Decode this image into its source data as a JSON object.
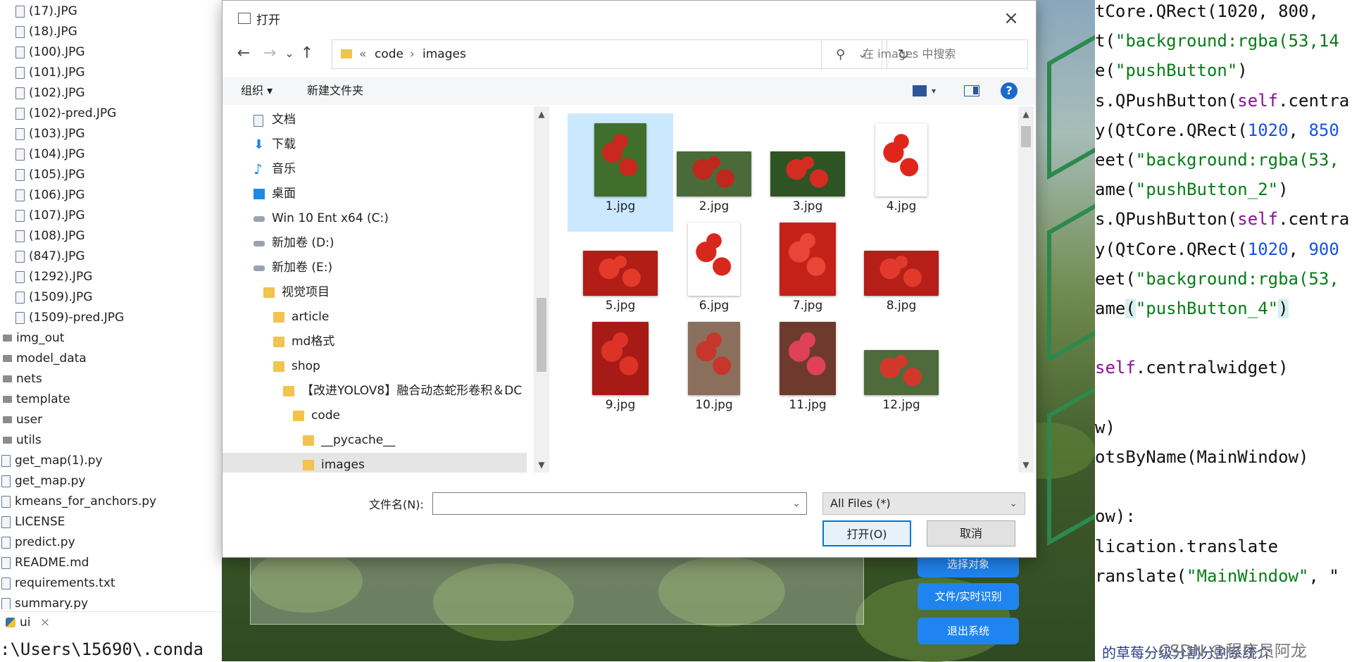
{
  "ide": {
    "tree": [
      {
        "name": "(17).JPG",
        "type": "file",
        "indent": 1
      },
      {
        "name": "(18).JPG",
        "type": "file",
        "indent": 1
      },
      {
        "name": "(100).JPG",
        "type": "file",
        "indent": 1
      },
      {
        "name": "(101).JPG",
        "type": "file",
        "indent": 1
      },
      {
        "name": "(102).JPG",
        "type": "file",
        "indent": 1
      },
      {
        "name": "(102)-pred.JPG",
        "type": "file",
        "indent": 1
      },
      {
        "name": "(103).JPG",
        "type": "file",
        "indent": 1
      },
      {
        "name": "(104).JPG",
        "type": "file",
        "indent": 1
      },
      {
        "name": "(105).JPG",
        "type": "file",
        "indent": 1
      },
      {
        "name": "(106).JPG",
        "type": "file",
        "indent": 1
      },
      {
        "name": "(107).JPG",
        "type": "file",
        "indent": 1
      },
      {
        "name": "(108).JPG",
        "type": "file",
        "indent": 1
      },
      {
        "name": "(847).JPG",
        "type": "file",
        "indent": 1
      },
      {
        "name": "(1292).JPG",
        "type": "file",
        "indent": 1
      },
      {
        "name": "(1509).JPG",
        "type": "file",
        "indent": 1
      },
      {
        "name": "(1509)-pred.JPG",
        "type": "file",
        "indent": 1
      },
      {
        "name": "img_out",
        "type": "dir",
        "indent": 0
      },
      {
        "name": "model_data",
        "type": "dir",
        "indent": 0
      },
      {
        "name": "nets",
        "type": "dir",
        "indent": 0
      },
      {
        "name": "template",
        "type": "dir",
        "indent": 0
      },
      {
        "name": "user",
        "type": "dir",
        "indent": 0
      },
      {
        "name": "utils",
        "type": "dir",
        "indent": 0
      },
      {
        "name": "get_map(1).py",
        "type": "file",
        "indent": 0
      },
      {
        "name": "get_map.py",
        "type": "file",
        "indent": 0
      },
      {
        "name": "kmeans_for_anchors.py",
        "type": "file",
        "indent": 0
      },
      {
        "name": "LICENSE",
        "type": "file",
        "indent": 0
      },
      {
        "name": "predict.py",
        "type": "file",
        "indent": 0
      },
      {
        "name": "README.md",
        "type": "file",
        "indent": 0
      },
      {
        "name": "requirements.txt",
        "type": "file",
        "indent": 0
      },
      {
        "name": "summary.py",
        "type": "file",
        "indent": 0
      }
    ],
    "run_tab": "ui",
    "run_tab_close": "×",
    "terminal": ":\\Users\\15690\\.conda",
    "code_lines": [
      {
        "segs": [
          {
            "t": "tCore.QRect(1020, 800,",
            "c": ""
          }
        ]
      },
      {
        "segs": [
          {
            "t": "t(",
            "c": ""
          },
          {
            "t": "\"background:rgba(53,14",
            "c": "s"
          }
        ]
      },
      {
        "segs": [
          {
            "t": "e(",
            "c": ""
          },
          {
            "t": "\"pushButton\"",
            "c": "s"
          },
          {
            "t": ")",
            "c": ""
          }
        ]
      },
      {
        "segs": [
          {
            "t": "s.QPushButton(",
            "c": ""
          },
          {
            "t": "self",
            "c": "k"
          },
          {
            "t": ".centra",
            "c": ""
          }
        ]
      },
      {
        "segs": [
          {
            "t": "y(QtCore.QRect(",
            "c": ""
          },
          {
            "t": "1020",
            "c": "n"
          },
          {
            "t": ", ",
            "c": ""
          },
          {
            "t": "850",
            "c": "n"
          }
        ]
      },
      {
        "segs": [
          {
            "t": "eet(",
            "c": ""
          },
          {
            "t": "\"background:rgba(53,",
            "c": "s"
          }
        ]
      },
      {
        "segs": [
          {
            "t": "ame(",
            "c": ""
          },
          {
            "t": "\"pushButton_2\"",
            "c": "s"
          },
          {
            "t": ")",
            "c": ""
          }
        ]
      },
      {
        "segs": [
          {
            "t": "s.QPushButton(",
            "c": ""
          },
          {
            "t": "self",
            "c": "k"
          },
          {
            "t": ".centra",
            "c": ""
          }
        ]
      },
      {
        "segs": [
          {
            "t": "y(QtCore.QRect(",
            "c": ""
          },
          {
            "t": "1020",
            "c": "n"
          },
          {
            "t": ", ",
            "c": ""
          },
          {
            "t": "900",
            "c": "n"
          }
        ]
      },
      {
        "segs": [
          {
            "t": "eet(",
            "c": ""
          },
          {
            "t": "\"background:rgba(53,",
            "c": "s"
          }
        ]
      },
      {
        "segs": [
          {
            "t": "ame",
            "c": ""
          },
          {
            "t": "(",
            "c": "hl"
          },
          {
            "t": "\"pushButton_4\"",
            "c": "s"
          },
          {
            "t": ")",
            "c": "hl"
          }
        ]
      },
      {
        "segs": [
          {
            "t": "",
            "c": ""
          }
        ]
      },
      {
        "segs": [
          {
            "t": "self",
            "c": "k"
          },
          {
            "t": ".centralwidget)",
            "c": ""
          }
        ]
      },
      {
        "segs": [
          {
            "t": "",
            "c": ""
          }
        ]
      },
      {
        "segs": [
          {
            "t": "w)",
            "c": ""
          }
        ]
      },
      {
        "segs": [
          {
            "t": "otsByName(MainWindow)",
            "c": ""
          }
        ]
      },
      {
        "segs": [
          {
            "t": "",
            "c": ""
          }
        ]
      },
      {
        "segs": [
          {
            "t": "ow):",
            "c": ""
          }
        ]
      },
      {
        "segs": [
          {
            "t": "lication.translate",
            "c": ""
          }
        ]
      },
      {
        "segs": [
          {
            "t": "ranslate(",
            "c": ""
          },
          {
            "t": "\"MainWindow\"",
            "c": "s"
          },
          {
            "t": ", \"",
            "c": ""
          }
        ]
      }
    ],
    "watermark": "CSDN @程序员阿龙",
    "watermark_under": "的草莓分级分割分割系统介"
  },
  "app": {
    "buttons": [
      "选择对象",
      "文件/实时识别",
      "退出系统"
    ]
  },
  "dialog": {
    "title": "打开",
    "close": "×",
    "nav": {
      "back": "←",
      "forward": "→",
      "recent": "⌄",
      "up": "↑"
    },
    "address": {
      "overflow": "«",
      "crumbs": [
        "code",
        "images"
      ],
      "sep": "›",
      "dropdown": "⌄",
      "refresh": "↻"
    },
    "search_placeholder": "在 images 中搜索",
    "toolbar": {
      "organize": "组织 ▾",
      "new_folder": "新建文件夹",
      "view_dd": "▾",
      "help": "?"
    },
    "nav_items": [
      {
        "label": "文档",
        "icon": "doc",
        "indent": 1
      },
      {
        "label": "下载",
        "icon": "download",
        "indent": 1
      },
      {
        "label": "音乐",
        "icon": "music",
        "indent": 1
      },
      {
        "label": "桌面",
        "icon": "desktop",
        "indent": 1
      },
      {
        "label": "Win 10 Ent x64 (C:)",
        "icon": "drive",
        "indent": 1
      },
      {
        "label": "新加卷 (D:)",
        "icon": "drive",
        "indent": 1
      },
      {
        "label": "新加卷 (E:)",
        "icon": "drive",
        "indent": 1
      },
      {
        "label": "视觉项目",
        "icon": "folder",
        "indent": 2
      },
      {
        "label": "article",
        "icon": "folder",
        "indent": 3
      },
      {
        "label": "md格式",
        "icon": "folder",
        "indent": 3
      },
      {
        "label": "shop",
        "icon": "folder",
        "indent": 3
      },
      {
        "label": "【改进YOLOV8】融合动态蛇形卷积＆DC",
        "icon": "folder",
        "indent": 4
      },
      {
        "label": "code",
        "icon": "folder",
        "indent": 5
      },
      {
        "label": "__pycache__",
        "icon": "folder",
        "indent": 6
      },
      {
        "label": "images",
        "icon": "folder",
        "indent": 6,
        "selected": true
      }
    ],
    "files": [
      {
        "name": "1.jpg",
        "selected": true,
        "color": "#3f6f2a",
        "accent": "#c8281e",
        "shape": "tall"
      },
      {
        "name": "2.jpg",
        "color": "#4b6a3a",
        "accent": "#c0271d",
        "shape": "wide"
      },
      {
        "name": "3.jpg",
        "color": "#2f5424",
        "accent": "#d42c20",
        "shape": "wide"
      },
      {
        "name": "4.jpg",
        "color": "#ffffff",
        "accent": "#e0261b",
        "shape": "tall"
      },
      {
        "name": "5.jpg",
        "color": "#b21d16",
        "accent": "#e33a2c",
        "shape": "wide"
      },
      {
        "name": "6.jpg",
        "color": "#ffffff",
        "accent": "#d8281c",
        "shape": "tall"
      },
      {
        "name": "7.jpg",
        "color": "#c42219",
        "accent": "#ea4536",
        "shape": "square"
      },
      {
        "name": "8.jpg",
        "color": "#b51f17",
        "accent": "#e13a2c",
        "shape": "wide"
      },
      {
        "name": "9.jpg",
        "color": "#a61b15",
        "accent": "#dd3327",
        "shape": "square"
      },
      {
        "name": "10.jpg",
        "color": "#8a6f5c",
        "accent": "#c7362a",
        "shape": "tall"
      },
      {
        "name": "11.jpg",
        "color": "#6f3a2e",
        "accent": "#e0415a",
        "shape": "square"
      },
      {
        "name": "12.jpg",
        "color": "#4f6b3c",
        "accent": "#d3372a",
        "shape": "wide"
      }
    ],
    "filename_label": "文件名(N):",
    "filename_value": "",
    "filetype": "All Files (*)",
    "open_label": "打开(O)",
    "cancel_label": "取消"
  }
}
